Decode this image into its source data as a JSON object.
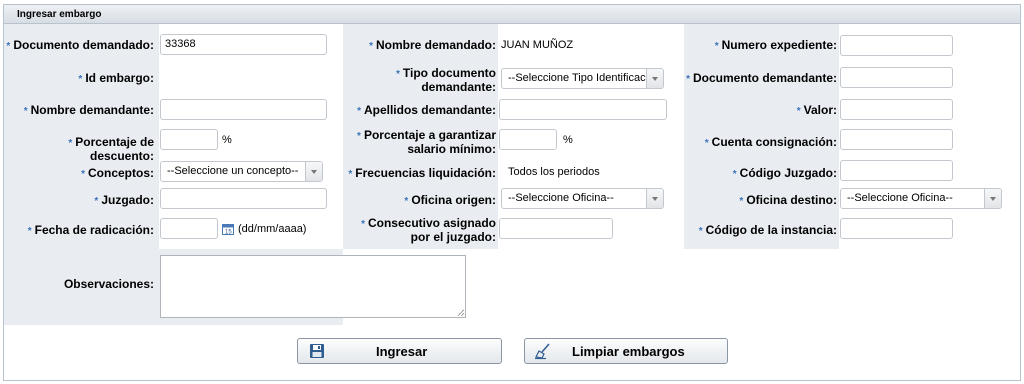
{
  "panel": {
    "title": "Ingresar embargo"
  },
  "col1": {
    "documento_demandado": {
      "label": "Documento demandado:",
      "value": "33368"
    },
    "id_embargo": {
      "label": "Id embargo:"
    },
    "nombre_demandante": {
      "label": "Nombre demandante:",
      "value": ""
    },
    "porcentaje_descuento": {
      "label": "Porcentaje de descuento:",
      "value": "",
      "unit": "%"
    },
    "conceptos": {
      "label": "Conceptos:",
      "selected": "--Seleccione un concepto--"
    },
    "juzgado": {
      "label": "Juzgado:",
      "value": ""
    },
    "fecha_radicacion": {
      "label": "Fecha de radicación:",
      "value": "",
      "hint": "(dd/mm/aaaa)"
    }
  },
  "col2": {
    "nombre_demandado": {
      "label": "Nombre demandado:",
      "value": "JUAN MUÑOZ"
    },
    "tipo_documento": {
      "label_line1": "Tipo documento",
      "label_line2": "demandante:",
      "selected": "--Seleccione Tipo Identificacio"
    },
    "apellidos_demandante": {
      "label": "Apellidos demandante:",
      "value": ""
    },
    "porcentaje_garantizar": {
      "label_line1": "Porcentaje a garantizar",
      "label_line2": "salario mínimo:",
      "value": "",
      "unit": "%"
    },
    "frecuencias_liquidacion": {
      "label": "Frecuencias liquidación:",
      "value": "Todos los periodos"
    },
    "oficina_origen": {
      "label": "Oficina origen:",
      "selected": "--Seleccione Oficina--"
    },
    "consecutivo": {
      "label_line1": "Consecutivo asignado",
      "label_line2": "por el juzgado:",
      "value": ""
    }
  },
  "col3": {
    "numero_expediente": {
      "label": "Numero expediente:",
      "value": ""
    },
    "documento_demandante": {
      "label": "Documento demandante:",
      "value": ""
    },
    "valor": {
      "label": "Valor:",
      "value": ""
    },
    "cuenta_consignacion": {
      "label": "Cuenta consignación:",
      "value": ""
    },
    "codigo_juzgado": {
      "label": "Código Juzgado:",
      "value": ""
    },
    "oficina_destino": {
      "label": "Oficina destino:",
      "selected": "--Seleccione Oficina--"
    },
    "codigo_instancia": {
      "label": "Código de la instancia:",
      "value": ""
    }
  },
  "observaciones": {
    "label": "Observaciones:",
    "value": ""
  },
  "buttons": {
    "ingresar": "Ingresar",
    "limpiar": "Limpiar embargos"
  },
  "required_marker": "*",
  "icons": {
    "calendar": "calendar-icon",
    "save": "floppy-disk-icon",
    "clear": "broom-icon"
  },
  "colors": {
    "accent": "#3b73b9",
    "panel_bg": "#e9edf1"
  }
}
